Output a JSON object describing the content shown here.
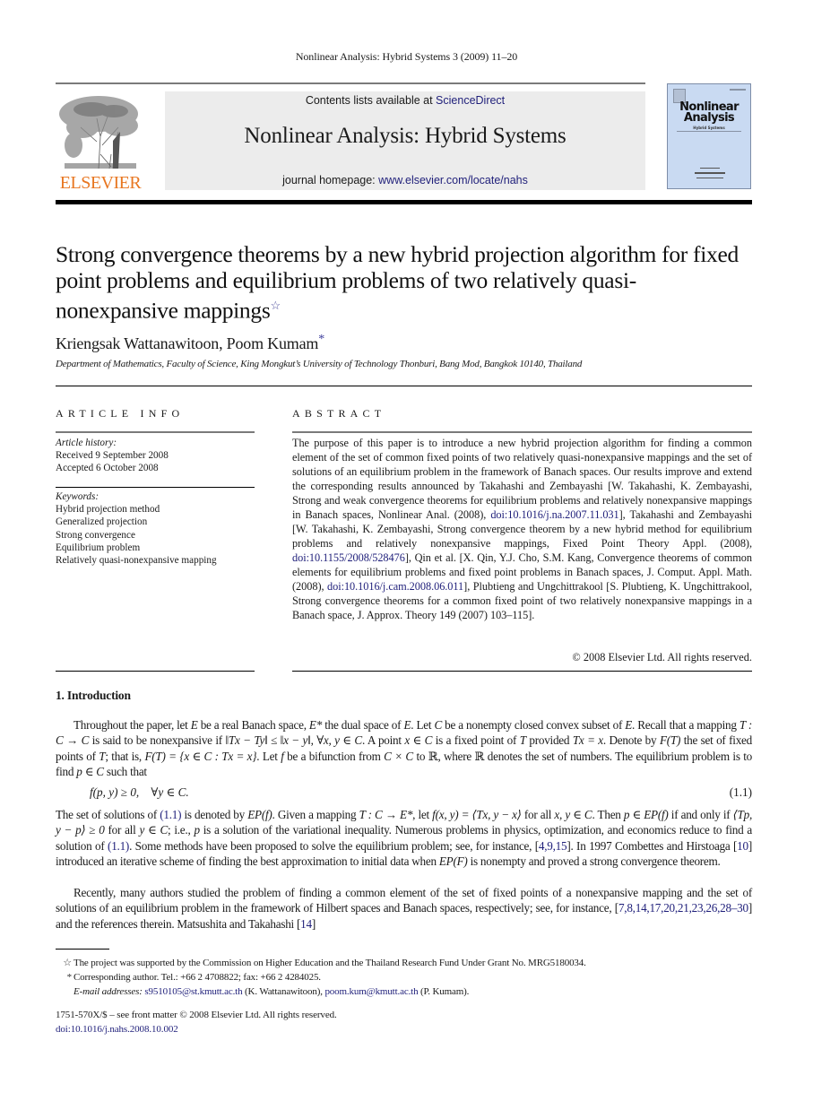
{
  "running_head": "Nonlinear Analysis: Hybrid Systems 3 (2009) 11–20",
  "masthead": {
    "publisher_logo_text": "ELSEVIER",
    "contents_prefix": "Contents lists available at ",
    "contents_link": "ScienceDirect",
    "journal_title": "Nonlinear Analysis: Hybrid Systems",
    "homepage_prefix": "journal homepage: ",
    "homepage_link": "www.elsevier.com/locate/nahs",
    "cover": {
      "title_line1": "Nonlinear",
      "title_line2": "Analysis",
      "subtitle": "Hybrid Systems"
    },
    "colors": {
      "elsevier_orange": "#e87722",
      "link_blue": "#1f1f7a",
      "banner_gray": "#ececec",
      "cover_blue": "#c9daf2"
    }
  },
  "article": {
    "title": "Strong convergence theorems by a new hybrid projection algorithm for fixed point problems and equilibrium problems of two relatively quasi-nonexpansive mappings",
    "title_footnote_mark": "☆",
    "authors": "Kriengsak Wattanawitoon, Poom Kumam",
    "author_mark": "*",
    "affiliation": "Department of Mathematics, Faculty of Science, King Mongkut’s University of Technology Thonburi, Bang Mod, Bangkok 10140, Thailand"
  },
  "article_info": {
    "heading": "ARTICLE INFO",
    "history_label": "Article history:",
    "received": "Received 9 September 2008",
    "accepted": "Accepted 6 October 2008",
    "keywords_label": "Keywords:",
    "keywords": [
      "Hybrid projection method",
      "Generalized projection",
      "Strong convergence",
      "Equilibrium problem",
      "Relatively quasi-nonexpansive mapping"
    ]
  },
  "abstract": {
    "heading": "ABSTRACT",
    "parts": [
      "The purpose of this paper is to introduce a new hybrid projection algorithm for finding a common element of the set of common fixed points of two relatively quasi-nonexpansive mappings and the set of solutions of an equilibrium problem in the framework of Banach spaces. Our results improve and extend the corresponding results announced by Takahashi and Zembayashi [W. Takahashi, K. Zembayashi, Strong and weak convergence theorems for equilibrium problems and relatively nonexpansive mappings in Banach spaces, Nonlinear Anal. (2008), ",
      "], Takahashi and Zembayashi [W. Takahashi, K. Zembayashi, Strong convergence theorem by a new hybrid method for equilibrium problems and relatively nonexpansive mappings, Fixed Point Theory Appl. (2008), ",
      "], Qin et al. [X. Qin, Y.J. Cho, S.M. Kang, Convergence theorems of common elements for equilibrium problems and fixed point problems in Banach spaces, J. Comput. Appl. Math. (2008), ",
      "], Plubtieng and Ungchittrakool [S. Plubtieng, K. Ungchittrakool, Strong convergence theorems for a common fixed point of two relatively nonexpansive mappings in a Banach space, J. Approx. Theory 149 (2007) 103–115]."
    ],
    "doi_links": [
      "doi:10.1016/j.na.2007.11.031",
      "doi:10.1155/2008/528476",
      "doi:10.1016/j.cam.2008.06.011"
    ],
    "copyright": "© 2008 Elsevier Ltd. All rights reserved."
  },
  "introduction": {
    "heading": "1.  Introduction",
    "p1": [
      "Throughout the paper, let ",
      "E",
      " be a real Banach space, ",
      "E*",
      " the dual space of ",
      "E",
      ". Let ",
      "C",
      " be a nonempty closed convex subset of ",
      "E",
      ". Recall that a mapping ",
      "T : C → C",
      " is said to be nonexpansive if ‖",
      "Tx − Ty",
      "‖ ≤ ‖",
      "x − y",
      "‖, ∀",
      "x, y ∈ C",
      ". A point ",
      "x ∈ C",
      " is a fixed point of ",
      "T",
      " provided ",
      "Tx = x",
      ". Denote by ",
      "F(T)",
      " the set of fixed points of ",
      "T",
      "; that is, ",
      "F(T) = {x ∈ C : Tx = x}",
      ". Let ",
      "f",
      " be a bifunction from ",
      "C × C",
      " to ℝ, where ℝ denotes the set of numbers. The equilibrium problem is to find ",
      "p ∈ C",
      " such that"
    ],
    "equation": "f(p, y) ≥ 0, ∀y ∈ C.",
    "equation_number": "(1.1)",
    "p2": [
      "The set of solutions of ",
      "(1.1)",
      " is denoted by ",
      "EP(f)",
      ". Given a mapping ",
      "T : C → E*",
      ", let ",
      "f(x, y) = ⟨Tx, y − x⟩",
      " for all ",
      "x, y ∈ C",
      ". Then ",
      "p ∈ EP(f)",
      " if and only if ",
      "⟨Tp, y − p⟩ ≥ 0",
      " for all ",
      "y ∈ C",
      "; i.e., ",
      "p",
      " is a solution of the variational inequality. Numerous problems in physics, optimization, and economics reduce to find a solution of ",
      "(1.1)",
      ". Some methods have been proposed to solve the equilibrium problem; see, for instance, [",
      "4,9,15",
      "]. In 1997 Combettes and Hirstoaga [",
      "10",
      "] introduced an iterative scheme of finding the best approximation to initial data when ",
      "EP(F)",
      " is nonempty and proved a strong convergence theorem."
    ],
    "p3": [
      "Recently, many authors studied the problem of finding a common element of the set of fixed points of a nonexpansive mapping and the set of solutions of an equilibrium problem in the framework of Hilbert spaces and Banach spaces, respectively; see, for instance, [",
      "7,8,14,17,20,21,23,26,28–30",
      "] and the references therein. Matsushita and Takahashi [",
      "14",
      "]"
    ]
  },
  "footnotes": {
    "fn1_mark": "☆",
    "fn1": "The project was supported by the Commission on Higher Education and the Thailand Research Fund Under Grant No. MRG5180034.",
    "fn2_mark": "*",
    "fn2": "Corresponding author. Tel.: +66 2 4708822; fax: +66 2 4284025.",
    "email_label": "E-mail addresses:",
    "email1": "s9510105@st.kmutt.ac.th",
    "email1_owner": " (K. Wattanawitoon), ",
    "email2": "poom.kum@kmutt.ac.th",
    "email2_owner": " (P. Kumam)."
  },
  "front_matter": {
    "issn_line": "1751-570X/$ – see front matter © 2008 Elsevier Ltd. All rights reserved.",
    "doi": "doi:10.1016/j.nahs.2008.10.002"
  }
}
